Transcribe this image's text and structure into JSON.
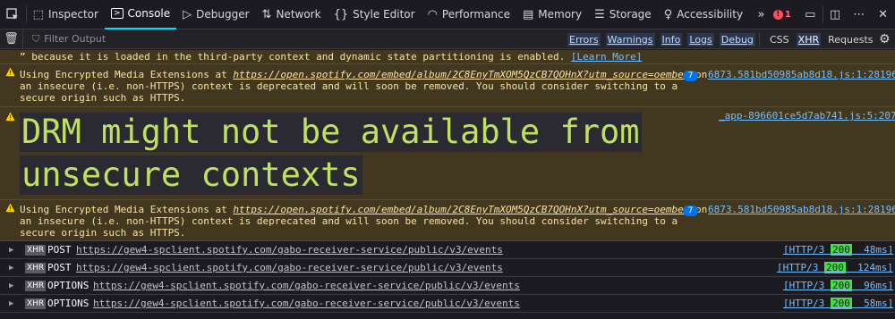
{
  "toolbar": {
    "tabs": [
      {
        "label": "Inspector",
        "icon": "inspector-icon"
      },
      {
        "label": "Console",
        "icon": "console-icon"
      },
      {
        "label": "Debugger",
        "icon": "debugger-icon"
      },
      {
        "label": "Network",
        "icon": "network-icon"
      },
      {
        "label": "Style Editor",
        "icon": "style-editor-icon"
      },
      {
        "label": "Performance",
        "icon": "performance-icon"
      },
      {
        "label": "Memory",
        "icon": "memory-icon"
      },
      {
        "label": "Storage",
        "icon": "storage-icon"
      },
      {
        "label": "Accessibility",
        "icon": "accessibility-icon"
      }
    ],
    "active_tab": "Console",
    "error_count": "1"
  },
  "filterbar": {
    "placeholder": "Filter Output",
    "levels": [
      "Errors",
      "Warnings",
      "Info",
      "Logs",
      "Debug"
    ],
    "cats": {
      "css": "CSS",
      "xhr": "XHR",
      "requests": "Requests"
    }
  },
  "messages": {
    "top_line": "” because it is loaded in the third-party context and dynamic state partitioning is enabled.",
    "learn_more": "[Learn More]",
    "w1": {
      "prefix": "Using Encrypted Media Extensions at ",
      "link": "https://open.spotify.com/embed/album/2C8EnyTmXOM5QzCB7QOHnX?utm_source=oembed",
      "suffix1": " on",
      "line2": "an insecure (i.e. non-HTTPS) context is deprecated and will soon be removed. You should consider switching to a",
      "line3": "secure origin such as HTTPS.",
      "count": "7",
      "source": "6873.581bd50985ab8d18.js:1:28196"
    },
    "drm": {
      "line1": "DRM might not be available from",
      "line2": "unsecure contexts",
      "source": "_app-896601ce5d7ab741.js:5:207"
    },
    "w2": {
      "prefix": "Using Encrypted Media Extensions at ",
      "link": "https://open.spotify.com/embed/album/2C8EnyTmXOM5QzCB7QOHnX?utm_source=oembed",
      "suffix1": " on",
      "line2": "an insecure (i.e. non-HTTPS) context is deprecated and will soon be removed. You should consider switching to a",
      "line3": "secure origin such as HTTPS.",
      "count": "7",
      "source": "6873.581bd50985ab8d18.js:1:28196"
    }
  },
  "requests": [
    {
      "tag": "XHR",
      "method": "POST",
      "url": "https://gew4-spclient.spotify.com/gabo-receiver-service/public/v3/events",
      "proto": "[HTTP/3 ",
      "code": "200",
      "time": "  48ms]"
    },
    {
      "tag": "XHR",
      "method": "POST",
      "url": "https://gew4-spclient.spotify.com/gabo-receiver-service/public/v3/events",
      "proto": "[HTTP/3 ",
      "code": "200",
      "time": "  124ms]"
    },
    {
      "tag": "XHR",
      "method": "OPTIONS",
      "url": "https://gew4-spclient.spotify.com/gabo-receiver-service/public/v3/events",
      "proto": "[HTTP/3 ",
      "code": "200",
      "time": "  96ms]"
    },
    {
      "tag": "XHR",
      "method": "OPTIONS",
      "url": "https://gew4-spclient.spotify.com/gabo-receiver-service/public/v3/events",
      "proto": "[HTTP/3 ",
      "code": "200",
      "time": "  58ms]"
    }
  ],
  "colors": {
    "warning_bg": "#42381f",
    "accent": "#00ddff",
    "error": "#ff4f5e",
    "status_ok": "#3fe044"
  }
}
